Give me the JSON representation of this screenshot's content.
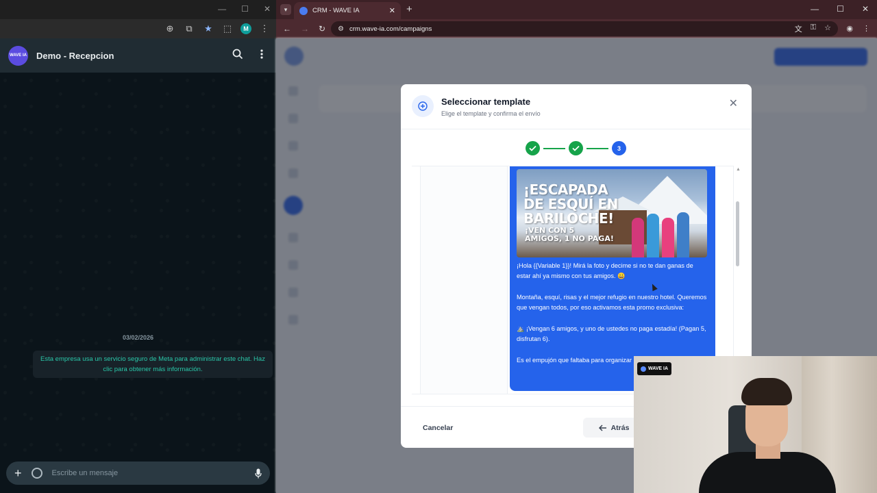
{
  "whatsapp": {
    "chat_name": "Demo - Recepcion",
    "avatar_text": "WAVE IA",
    "profile_initial": "M",
    "date_chip": "03/02/2026",
    "system_notice": "Esta empresa usa un servicio seguro de Meta para administrar este chat. Haz clic para obtener más información.",
    "input_placeholder": "Escribe un mensaje"
  },
  "browser": {
    "tab_title": "CRM - WAVE IA",
    "url": "crm.wave-ia.com/campaigns"
  },
  "modal": {
    "title": "Seleccionar template",
    "subtitle": "Elige el template y confirma el envío",
    "steps": [
      {
        "state": "done"
      },
      {
        "state": "done"
      },
      {
        "state": "current",
        "label": "3"
      }
    ],
    "preview": {
      "image_title": "¡ESCAPADA DE ESQUÍ EN BARILOCHE!",
      "image_subtitle": "¡VEN CON 5 AMIGOS, 1 NO PAGA!",
      "message_p1": "¡Hola {{Variable 1}}! Mirá la foto y decime si no te dan ganas de estar ahí ya mismo con tus amigos. 😀",
      "message_p2": "Montaña, esquí, risas y el mejor refugio en nuestro hotel. Queremos que vengan todos, por eso activamos esta promo exclusiva:",
      "message_p3": "⛰️ ¡Vengan 6 amigos, y uno de ustedes no paga estadía! (Pagan 5, disfrutan 6).",
      "message_p4": "Es el empujón que faltaba para organizar el viaje a Bariloche."
    },
    "cancel_label": "Cancelar",
    "back_label": "Atrás"
  },
  "webcam": {
    "logo_text": "WAVE IA"
  },
  "colors": {
    "primary": "#2563eb",
    "success": "#16a34a",
    "wa_bg": "#0b141a",
    "wa_accent": "#2ac6a8"
  }
}
